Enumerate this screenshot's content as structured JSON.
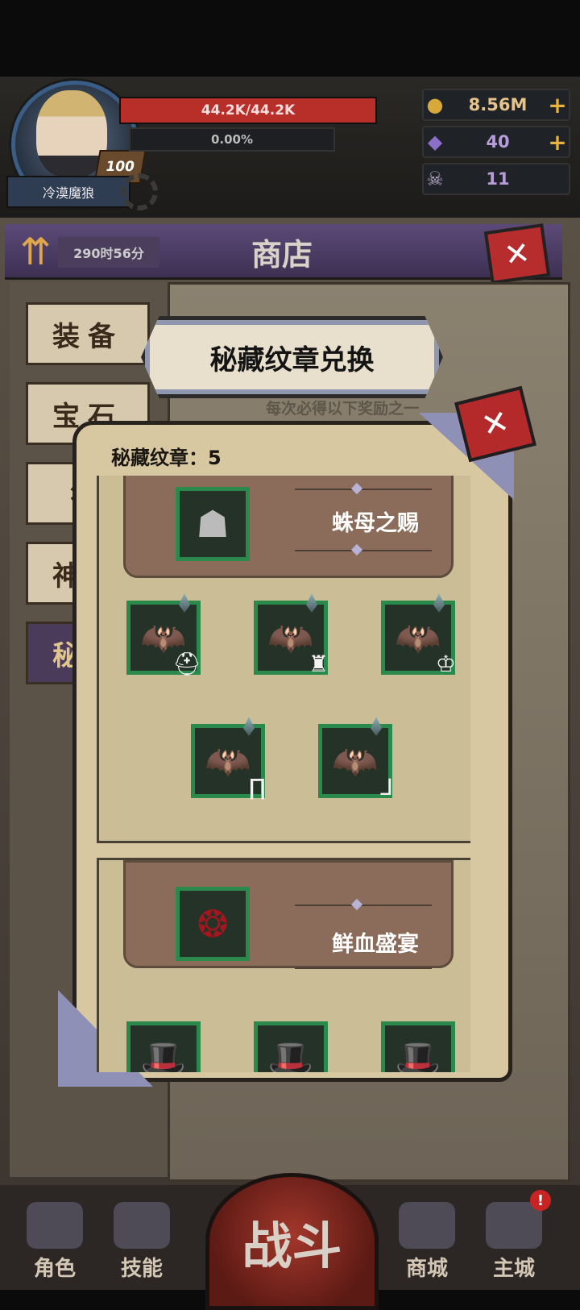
{
  "player": {
    "name": "冷漠魔狼",
    "level": "100",
    "hp": "44.2K/44.2K",
    "xp": "0.00%"
  },
  "resources": [
    {
      "icon": "gold-coin-icon",
      "value": "8.56M",
      "has_plus": true,
      "color": "#e6c38a"
    },
    {
      "icon": "purple-crystal-icon",
      "value": "40",
      "has_plus": true,
      "color": "#b79cd9"
    },
    {
      "icon": "ram-skull-icon",
      "value": "11",
      "has_plus": false,
      "color": "#b79cd9"
    }
  ],
  "shop": {
    "title": "商店",
    "timer": "290时56分",
    "close": "✕",
    "tabs": [
      {
        "label": "装备",
        "active": false
      },
      {
        "label": "宝石",
        "active": false
      },
      {
        "label": "符",
        "active": false
      },
      {
        "label": "神秘",
        "active": false
      },
      {
        "label": "秘藏",
        "active": true
      }
    ]
  },
  "exchange": {
    "banner_title": "秘藏纹章兑换",
    "banner_subtitle": "每次必得以下奖励之一",
    "emblem_label": "秘藏纹章：5",
    "close": "✕",
    "packs": [
      {
        "name": "蛛母之赐",
        "header_icon": "spider-mask-icon",
        "items": [
          {
            "icon": "bat-wing-helmet-icon"
          },
          {
            "icon": "bat-wing-armor-icon"
          },
          {
            "icon": "bat-wing-mask-icon"
          },
          {
            "icon": "bat-wing-pants-icon"
          },
          {
            "icon": "bat-wing-boots-icon"
          }
        ]
      },
      {
        "name": "鲜血盛宴",
        "header_icon": "thorn-crown-icon",
        "items": [
          {
            "icon": "rose-hat-icon"
          },
          {
            "icon": "rose-hat-icon"
          },
          {
            "icon": "rose-hat-icon"
          }
        ]
      }
    ]
  },
  "nav": {
    "role": "角色",
    "skill": "技能",
    "battle": "战斗",
    "mall": "商城",
    "city": "主城",
    "alert": "!"
  },
  "colors": {
    "accent_purple": "#5c4a78",
    "close_red": "#b72c2c",
    "slot_green": "#2a8a4b",
    "parchment": "#d8c8a2"
  }
}
